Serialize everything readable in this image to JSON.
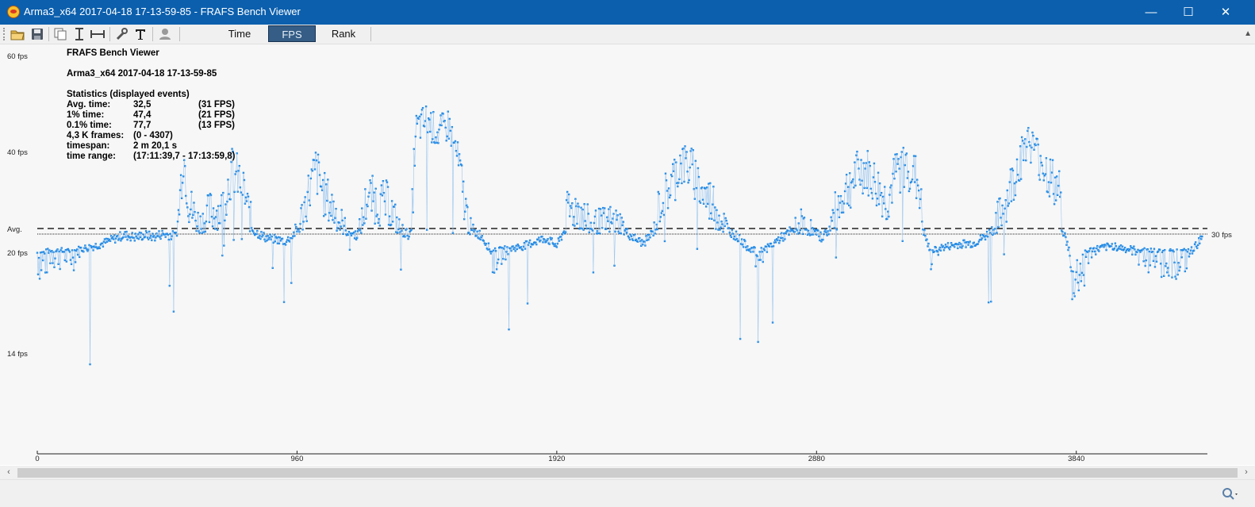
{
  "window": {
    "title": "Arma3_x64 2017-04-18 17-13-59-85 - FRAFS Bench Viewer",
    "controls": {
      "minimize": "—",
      "maximize": "☐",
      "close": "✕"
    }
  },
  "toolbar": {
    "icons": [
      "open-folder-icon",
      "save-icon",
      "copy-icon",
      "fit-vertical-icon",
      "fit-horizontal-icon",
      "settings-wrench-icon",
      "text-icon",
      "user-icon"
    ],
    "buttons": {
      "time": "Time",
      "fps": "FPS",
      "rank": "Rank"
    },
    "active": "FPS"
  },
  "stats": {
    "app_title": "FRAFS Bench Viewer",
    "file_name": "Arma3_x64 2017-04-18 17-13-59-85",
    "section": "Statistics (displayed events)",
    "rows": [
      {
        "label": "Avg. time:",
        "value": "32,5",
        "extra": "(31 FPS)"
      },
      {
        "label": "1% time:",
        "value": "47,4",
        "extra": "(21 FPS)"
      },
      {
        "label": "0.1% time:",
        "value": "77,7",
        "extra": "(13 FPS)"
      },
      {
        "label": "4,3 K frames:",
        "value": "(0 - 4307)",
        "extra": ""
      },
      {
        "label": "timespan:",
        "value": "2 m 20,1 s",
        "extra": ""
      },
      {
        "label": "time range:",
        "value": "(17:11:39,7 - 17:13:59,8)",
        "extra": ""
      }
    ]
  },
  "chart_data": {
    "type": "scatter",
    "title": "",
    "xlabel": "",
    "ylabel": "",
    "xlim": [
      0,
      4307
    ],
    "y_ticks": [
      {
        "label": "60 fps",
        "value": 60
      },
      {
        "label": "40 fps",
        "value": 40
      },
      {
        "label": "Avg.",
        "value": 31
      },
      {
        "label": "20 fps",
        "value": 20
      },
      {
        "label": "14 fps",
        "value": 14
      }
    ],
    "x_ticks": [
      0,
      960,
      1920,
      2880,
      3840
    ],
    "reference_lines": [
      {
        "label": "Avg.",
        "value": 31,
        "style": "dashed"
      },
      {
        "label": "30 fps",
        "value": 30,
        "style": "dotted"
      }
    ],
    "series_color": "#1e88e5",
    "series": [
      {
        "x": [
          0,
          20,
          50,
          90,
          120,
          160,
          200,
          240,
          280,
          320,
          360,
          400,
          430,
          460,
          490,
          510,
          540,
          560,
          600,
          640,
          680,
          720,
          760,
          800,
          840,
          880,
          920,
          960,
          1000,
          1030,
          1060,
          1100,
          1140,
          1180,
          1220,
          1260,
          1300,
          1340,
          1380,
          1400,
          1440,
          1480,
          1520,
          1560,
          1600,
          1640,
          1680,
          1720,
          1760,
          1800,
          1840,
          1880,
          1920,
          1960,
          2000,
          2040,
          2080,
          2120,
          2160,
          2200,
          2240,
          2280,
          2300,
          2340,
          2380,
          2420,
          2460,
          2500,
          2540,
          2580,
          2620,
          2660,
          2700,
          2740,
          2780,
          2820,
          2860,
          2900,
          2940,
          2980,
          3020,
          3060,
          3100,
          3140,
          3180,
          3220,
          3260,
          3300,
          3340,
          3380,
          3420,
          3460,
          3500,
          3540,
          3580,
          3620,
          3660,
          3700,
          3740,
          3780,
          3820,
          3860,
          3900,
          3940,
          3980,
          4020,
          4060,
          4100,
          4140,
          4180,
          4220,
          4260,
          4290,
          4307
        ],
        "y": [
          20,
          19.5,
          20.5,
          20.5,
          20,
          21.5,
          22.5,
          24,
          26,
          28,
          27,
          28,
          27,
          28.5,
          28,
          27.5,
          40,
          34,
          31,
          33,
          33,
          38,
          36,
          30,
          27,
          26,
          25,
          30,
          35,
          38,
          35,
          33,
          30,
          28,
          35,
          34,
          34,
          30,
          28,
          45,
          47,
          44,
          46,
          38,
          30,
          28,
          20,
          21,
          22,
          23,
          25,
          26.5,
          23,
          33,
          33.5,
          31,
          31,
          31.5,
          31,
          27,
          24,
          30,
          34,
          36,
          39,
          38,
          35,
          34,
          31,
          28,
          23,
          20,
          22,
          26,
          29,
          31,
          30,
          27,
          32,
          35,
          37,
          38,
          36,
          34,
          38,
          38.5,
          36,
          20,
          22,
          23,
          24,
          24,
          27,
          31,
          34,
          38,
          43,
          40,
          37,
          35,
          18,
          19,
          21,
          22,
          23,
          21.5,
          21,
          20.5,
          20,
          20,
          20,
          20,
          24,
          30
        ]
      }
    ]
  },
  "statusbar": {
    "zoom_icon": "zoom-icon"
  },
  "scrollbar": {
    "left": "‹",
    "right": "›"
  }
}
